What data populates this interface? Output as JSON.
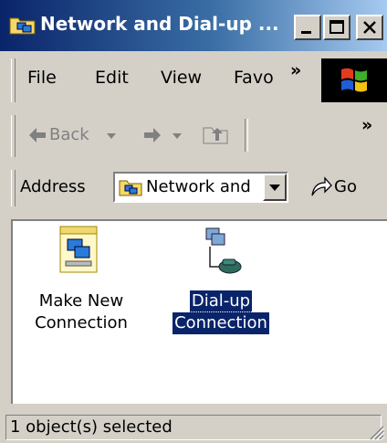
{
  "window": {
    "title": "Network and Dial-up ..."
  },
  "menu": {
    "items": [
      "File",
      "Edit",
      "View",
      "Favo"
    ],
    "overflow": "»"
  },
  "toolbar": {
    "back_label": "Back",
    "overflow": "»"
  },
  "address": {
    "label": "Address",
    "value": "Network and",
    "go_label": "Go"
  },
  "items": [
    {
      "label_line1": "Make New",
      "label_line2": "Connection",
      "selected": false
    },
    {
      "label_line1": "Dial-up",
      "label_line2": "Connection",
      "selected": true
    }
  ],
  "status": {
    "text": "1 object(s) selected"
  },
  "colors": {
    "title_start": "#0a246a",
    "title_end": "#a6caf0",
    "face": "#d4d0c8",
    "selection": "#0a246a"
  }
}
